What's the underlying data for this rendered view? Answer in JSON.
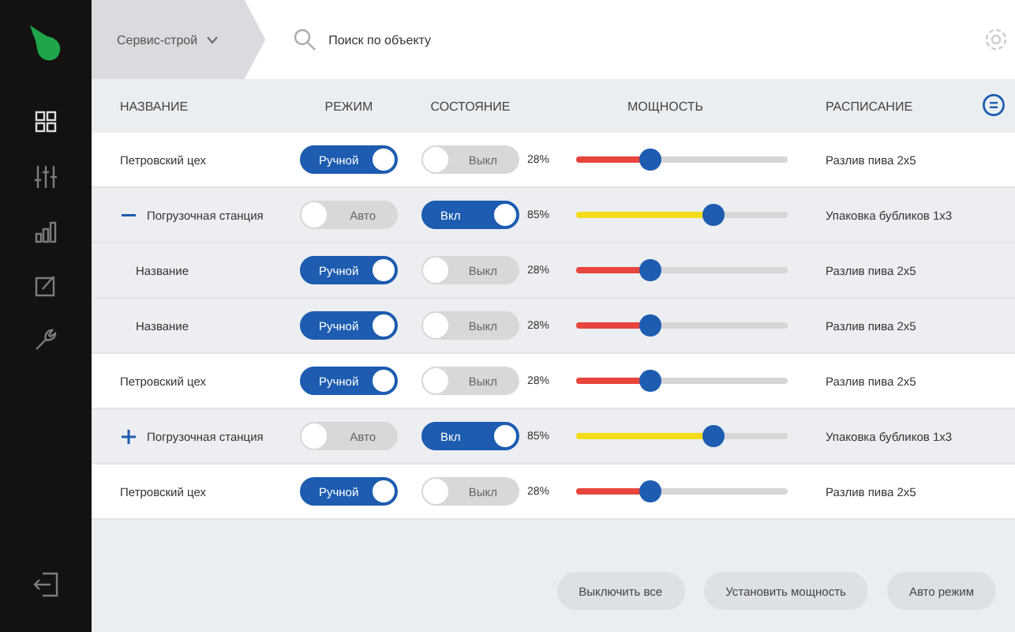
{
  "topbar": {
    "breadcrumb": "Сервис-строй",
    "search": {
      "placeholder": "Поиск по объекту"
    }
  },
  "table": {
    "columns": [
      "НАЗВАНИЕ",
      "РЕЖИМ",
      "СОСТОЯНИЕ",
      "МОЩНОСТЬ",
      "РАСПИСАНИЕ"
    ],
    "rows": [
      {
        "name": "Петровский цех",
        "mode": {
          "label": "Ручной",
          "on": true
        },
        "state": {
          "label": "Выкл",
          "on": false
        },
        "power": {
          "reading": "28%",
          "level": 0.35,
          "color": "#e8453c"
        },
        "schedule": "Разлив пива 2х5"
      },
      {
        "name": "Погрузочная станция",
        "expanded": true,
        "mode": {
          "label": "Авто",
          "on": false
        },
        "state": {
          "label": "Вкл",
          "on": true
        },
        "power": {
          "reading": "85%",
          "level": 0.65,
          "color": "#f5dc1a"
        },
        "schedule": "Упаковка бубликов 1х3",
        "children": [
          {
            "name": "Название",
            "mode": {
              "label": "Ручной",
              "on": true
            },
            "state": {
              "label": "Выкл",
              "on": false
            },
            "power": {
              "reading": "28%",
              "level": 0.35,
              "color": "#e8453c"
            },
            "schedule": "Разлив пива 2х5"
          },
          {
            "name": "Название",
            "mode": {
              "label": "Ручной",
              "on": true
            },
            "state": {
              "label": "Выкл",
              "on": false
            },
            "power": {
              "reading": "28%",
              "level": 0.35,
              "color": "#e8453c"
            },
            "schedule": "Разлив пива 2х5"
          }
        ]
      },
      {
        "name": "Петровский цех",
        "mode": {
          "label": "Ручной",
          "on": true
        },
        "state": {
          "label": "Выкл",
          "on": false
        },
        "power": {
          "reading": "28%",
          "level": 0.35,
          "color": "#e8453c"
        },
        "schedule": "Разлив пива 2х5"
      },
      {
        "name": "Погрузочная станция",
        "expanded": false,
        "mode": {
          "label": "Авто",
          "on": false
        },
        "state": {
          "label": "Вкл",
          "on": true
        },
        "power": {
          "reading": "85%",
          "level": 0.65,
          "color": "#f5dc1a"
        },
        "schedule": "Упаковка бубликов 1х3",
        "children": []
      },
      {
        "name": "Петровский цех",
        "mode": {
          "label": "Ручной",
          "on": true
        },
        "state": {
          "label": "Выкл",
          "on": false
        },
        "power": {
          "reading": "28%",
          "level": 0.35,
          "color": "#e8453c"
        },
        "schedule": "Разлив пива 2х5"
      }
    ]
  },
  "buttons": [
    "Выключить все",
    "Установить мощность",
    "Авто режим"
  ]
}
